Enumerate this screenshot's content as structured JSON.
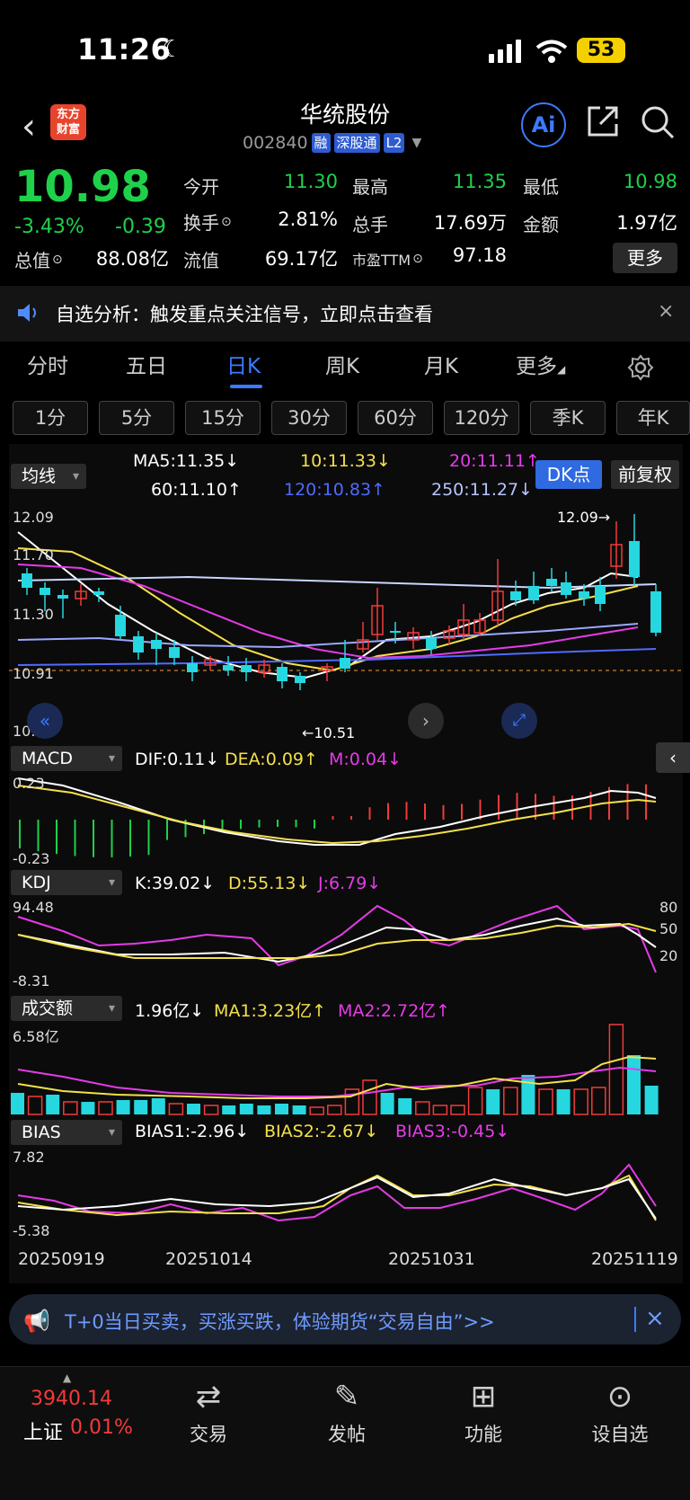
{
  "status": {
    "time": "11:26",
    "battery": "53"
  },
  "header": {
    "logo_line1": "东方",
    "logo_line2": "财富",
    "name": "华统股份",
    "code": "002840",
    "tags": [
      "融",
      "深股通",
      "L2"
    ],
    "ai": "Ai"
  },
  "quote": {
    "price": "10.98",
    "pct": "-3.43%",
    "change": "-0.39",
    "fields": [
      {
        "label": "今开",
        "value": "11.30",
        "color": "green"
      },
      {
        "label": "最高",
        "value": "11.35",
        "color": "green"
      },
      {
        "label": "最低",
        "value": "10.98",
        "color": "green"
      },
      {
        "label": "换手",
        "value": "2.81%",
        "color": "white"
      },
      {
        "label": "总手",
        "value": "17.69万",
        "color": "white"
      },
      {
        "label": "金额",
        "value": "1.97亿",
        "color": "white"
      },
      {
        "label": "总值",
        "value": "88.08亿",
        "color": "white"
      },
      {
        "label": "流值",
        "value": "69.17亿",
        "color": "white"
      },
      {
        "label": "市盈TTM",
        "value": "97.18",
        "color": "white"
      }
    ],
    "more": "更多"
  },
  "notice": {
    "text": "自选分析：触发重点关注信号，立即点击查看",
    "close": "×"
  },
  "tabs": [
    "分时",
    "五日",
    "日K",
    "周K",
    "月K",
    "更多"
  ],
  "active_tab": "日K",
  "chips": [
    "1分",
    "5分",
    "15分",
    "30分",
    "60分",
    "120分",
    "季K",
    "年K"
  ],
  "main_chart": {
    "indicator": "均线",
    "ma": {
      "ma5": "MA5:11.35↓",
      "ma10": "10:11.33↓",
      "ma20": "20:11.11↑",
      "ma60": "60:11.10↑",
      "ma120": "120:10.83↑",
      "ma250": "250:11.27↓"
    },
    "dk": "DK点",
    "fq": "前复权",
    "ymax": "12.09",
    "y2": "11.70",
    "y3": "11.30",
    "y4": "10.91",
    "ymin": "10.51",
    "high_label": "12.09→",
    "low_label": "←10.51",
    "ma_colors": {
      "ma5": "#ffffff",
      "ma10": "#f4e04a",
      "ma20": "#e53be8",
      "ma60": "#9aa8ff",
      "ma120": "#4f6bff",
      "ma250": "#c9d6ff"
    }
  },
  "macd": {
    "label": "MACD",
    "dif": "DIF:0.11↓",
    "dea": "DEA:0.09↑",
    "m": "M:0.04↓",
    "ymax": "0.23",
    "ymin": "-0.23"
  },
  "kdj": {
    "label": "KDJ",
    "k": "K:39.02↓",
    "d": "D:55.13↓",
    "j": "J:6.79↓",
    "ymax": "94.48",
    "ymin": "-8.31",
    "r80": "80",
    "r50": "50",
    "r20": "20"
  },
  "volume": {
    "label": "成交额",
    "v": "1.96亿↓",
    "ma1": "MA1:3.23亿↑",
    "ma2": "MA2:2.72亿↑",
    "ymax": "6.58亿"
  },
  "bias": {
    "label": "BIAS",
    "b1": "BIAS1:-2.96↓",
    "b2": "BIAS2:-2.67↓",
    "b3": "BIAS3:-0.45↓",
    "ymax": "7.82",
    "ymin": "-5.38"
  },
  "dates": [
    "20250919",
    "20251014",
    "20251031",
    "20251119"
  ],
  "ticker": {
    "text": "T+0当日买卖，买涨买跌，体验期货“交易自由”>>",
    "close": "×"
  },
  "bottom": {
    "index_value": "3940.14",
    "index_name": "上证",
    "index_pct": "0.01%",
    "items": [
      "交易",
      "发帖",
      "功能",
      "设自选"
    ]
  }
}
